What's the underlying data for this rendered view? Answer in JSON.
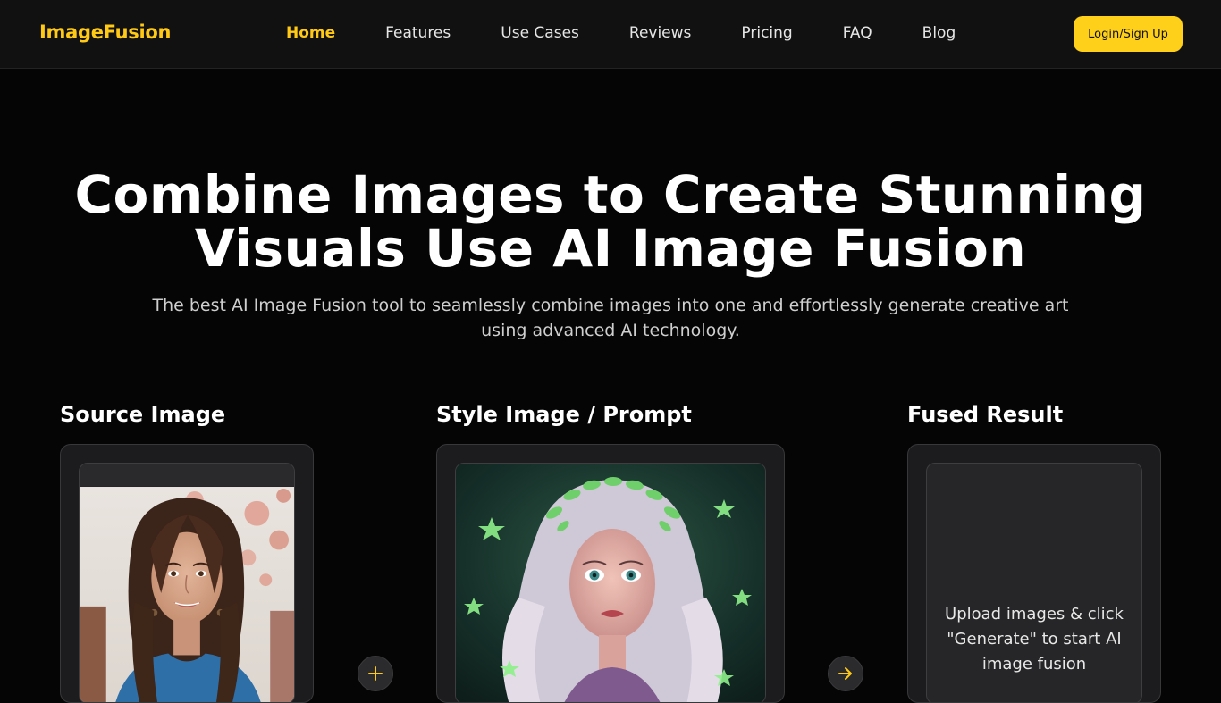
{
  "brand": {
    "name": "ImageFusion",
    "accent": "#ffc915"
  },
  "nav": {
    "items": [
      {
        "label": "Home",
        "active": true
      },
      {
        "label": "Features"
      },
      {
        "label": "Use Cases"
      },
      {
        "label": "Reviews"
      },
      {
        "label": "Pricing"
      },
      {
        "label": "FAQ"
      },
      {
        "label": "Blog"
      }
    ],
    "login_label": "Login/Sign Up"
  },
  "hero": {
    "title_line1": "Combine Images to Create Stunning",
    "title_line2": "Visuals Use AI Image Fusion",
    "subtitle": "The best AI Image Fusion tool to seamlessly combine images into one and effortlessly generate creative art using advanced AI technology."
  },
  "columns": {
    "source_title": "Source Image",
    "style_title": "Style Image / Prompt",
    "result_title": "Fused Result",
    "result_placeholder": "Upload images & click \"Generate\" to start AI image fusion"
  },
  "icons": {
    "combine": "plus-icon",
    "generate": "arrow-right-icon"
  }
}
